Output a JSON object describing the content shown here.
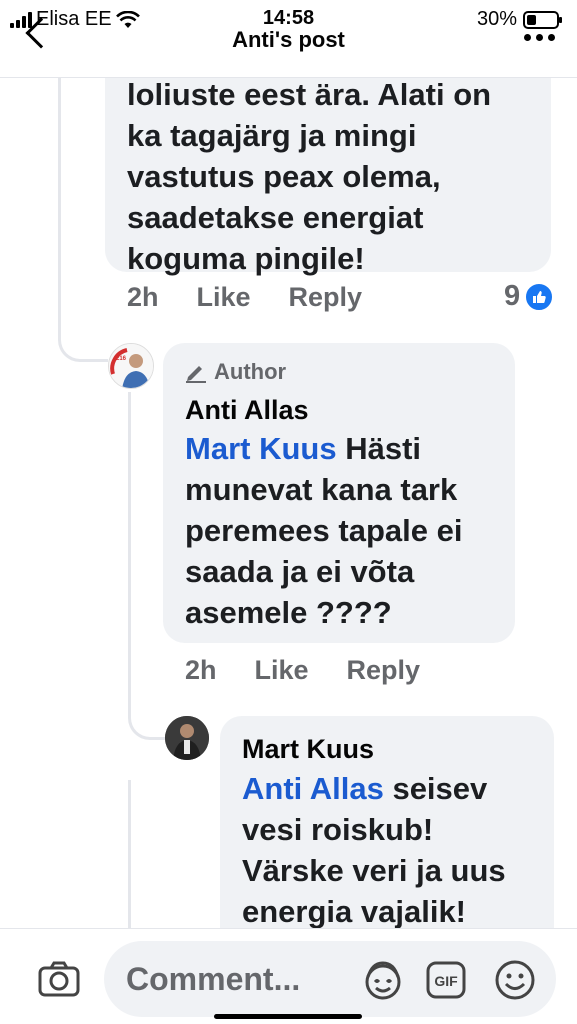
{
  "status_bar": {
    "carrier": "Elisa EE",
    "time": "14:58",
    "battery": "30%"
  },
  "header": {
    "title": "Anti's post"
  },
  "comments": [
    {
      "text_lines": [
        "loliuste eest ära. Alati on",
        "ka tagajärg ja mingi",
        "vastutus peax olema,",
        "saadetakse energiat",
        "koguma pingile!"
      ],
      "time": "2h",
      "like_label": "Like",
      "reply_label": "Reply",
      "reaction_count": "9"
    },
    {
      "author_badge": "Author",
      "author": "Anti Allas",
      "mention": "Mart Kuus",
      "text_lines": [
        "Hästi",
        "munevat kana tark",
        "peremees tapale ei",
        "saada ja ei võta",
        "asemele ????"
      ],
      "time": "2h",
      "like_label": "Like",
      "reply_label": "Reply"
    },
    {
      "author": "Mart Kuus",
      "mention": "Anti Allas",
      "text_lines": [
        "seisev",
        "vesi roiskub!",
        "Värske veri ja uus",
        "energia vajalik!"
      ]
    }
  ],
  "composer": {
    "placeholder": "Comment..."
  },
  "icons": {
    "back": "chevron-left-icon",
    "more": "more-dots-icon",
    "like": "thumbs-up-icon",
    "camera": "camera-icon",
    "avatar_sticker": "avatar-sticker-icon",
    "gif": "gif-icon",
    "emoji": "emoji-icon",
    "pencil": "pencil-icon"
  },
  "colors": {
    "mention": "#1b5bd0",
    "like_blue": "#1877f2",
    "bubble": "#f0f2f5",
    "secondary_text": "#65676b"
  }
}
